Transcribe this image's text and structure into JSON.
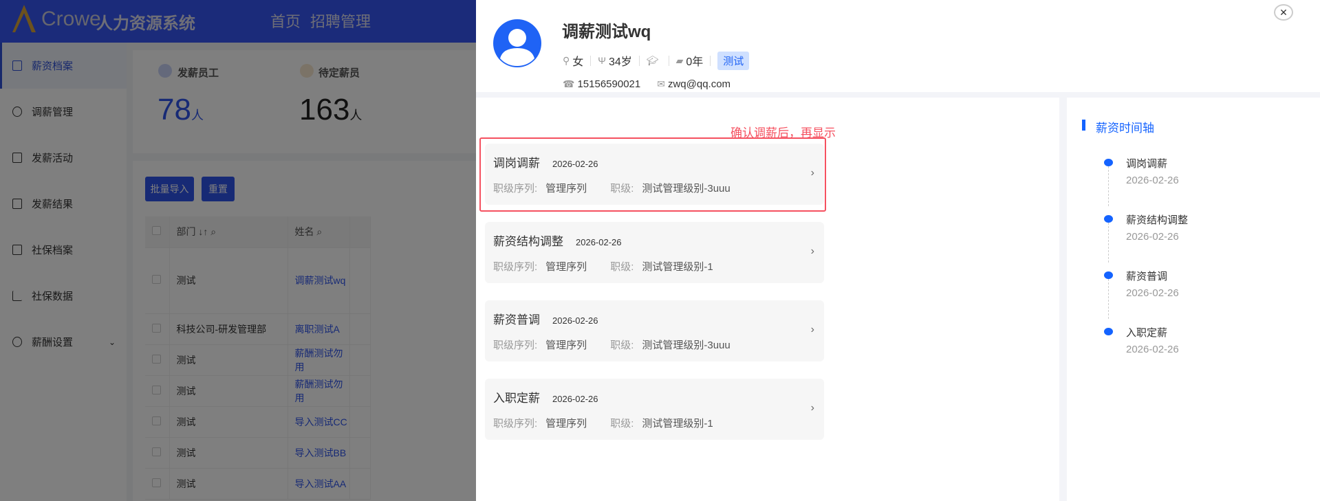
{
  "app": {
    "brand": "Crowe",
    "title": "人力资源系统",
    "nav": [
      "首页",
      "招聘管理"
    ]
  },
  "sidebar": {
    "items": [
      {
        "label": "薪资档案",
        "active": true
      },
      {
        "label": "调薪管理"
      },
      {
        "label": "发薪活动"
      },
      {
        "label": "发薪结果"
      },
      {
        "label": "社保档案"
      },
      {
        "label": "社保数据"
      },
      {
        "label": "薪酬设置"
      }
    ]
  },
  "stats": [
    {
      "label": "发薪员工",
      "value": "78",
      "unit": "人"
    },
    {
      "label": "待定薪员",
      "value": "163",
      "unit": "人"
    }
  ],
  "toolbar": {
    "import": "批量导入",
    "reset": "重置"
  },
  "table": {
    "headers": [
      "部门",
      "姓名"
    ],
    "rows": [
      [
        "测试",
        "调薪测试wq"
      ],
      [
        "科技公司-研发管理部",
        "离职测试A"
      ],
      [
        "测试",
        "薪酬测试勿用"
      ],
      [
        "测试",
        "薪酬测试勿用"
      ],
      [
        "测试",
        "导入测试CC"
      ],
      [
        "测试",
        "导入测试BB"
      ],
      [
        "测试",
        "导入测试AA"
      ]
    ]
  },
  "profile": {
    "name": "调薪测试wq",
    "gender": "女",
    "age": "34岁",
    "years": "0年",
    "tag": "测试",
    "phone": "15156590021",
    "email": "zwq@qq.com"
  },
  "annotation": "确认调薪后，再显示",
  "records": [
    {
      "title": "调岗调薪",
      "date": "2026-02-26",
      "seq_label": "职级序列:",
      "seq": "管理序列",
      "level_label": "职级:",
      "level": "测试管理级别-3uuu"
    },
    {
      "title": "薪资结构调整",
      "date": "2026-02-26",
      "seq_label": "职级序列:",
      "seq": "管理序列",
      "level_label": "职级:",
      "level": "测试管理级别-1"
    },
    {
      "title": "薪资普调",
      "date": "2026-02-26",
      "seq_label": "职级序列:",
      "seq": "管理序列",
      "level_label": "职级:",
      "level": "测试管理级别-3uuu"
    },
    {
      "title": "入职定薪",
      "date": "2026-02-26",
      "seq_label": "职级序列:",
      "seq": "管理序列",
      "level_label": "职级:",
      "level": "测试管理级别-1"
    }
  ],
  "timeline": {
    "title": "薪资时间轴",
    "items": [
      {
        "label": "调岗调薪",
        "date": "2026-02-26"
      },
      {
        "label": "薪资结构调整",
        "date": "2026-02-26"
      },
      {
        "label": "薪资普调",
        "date": "2026-02-26"
      },
      {
        "label": "入职定薪",
        "date": "2026-02-26"
      }
    ]
  },
  "colors": {
    "accent": "#1463ff",
    "annotation": "#f5505f",
    "header": "#3656f4"
  }
}
